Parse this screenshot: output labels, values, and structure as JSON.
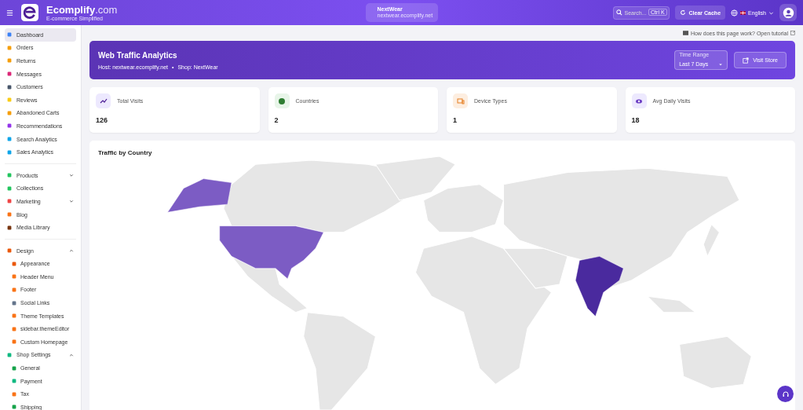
{
  "header": {
    "brand": "Ecomplify",
    "brand_suffix": ".com",
    "tagline": "E-commerce Simplified",
    "store": {
      "name": "NextWear",
      "host": "nextwear.ecomplify.net"
    },
    "search": {
      "placeholder": "Search...",
      "shortcut": "Ctrl K"
    },
    "clear_cache": "Clear Cache",
    "language": "English"
  },
  "sidebar": {
    "sections": [
      {
        "items": [
          {
            "label": "Dashboard",
            "selected": true
          },
          {
            "label": "Orders",
            "selected": false
          },
          {
            "label": "Returns",
            "selected": false
          },
          {
            "label": "Messages",
            "selected": false
          },
          {
            "label": "Customers",
            "selected": false
          },
          {
            "label": "Reviews",
            "selected": false
          },
          {
            "label": "Abandoned Carts",
            "selected": false
          },
          {
            "label": "Recommendations",
            "selected": false
          },
          {
            "label": "Search Analytics",
            "selected": false
          },
          {
            "label": "Sales Analytics",
            "selected": false
          }
        ]
      },
      {
        "items": [
          {
            "label": "Products",
            "selected": false,
            "expanded": false
          },
          {
            "label": "Collections",
            "selected": false
          },
          {
            "label": "Marketing",
            "selected": false,
            "expanded": false
          },
          {
            "label": "Blog",
            "selected": false
          },
          {
            "label": "Media Library",
            "selected": false
          }
        ]
      },
      {
        "items": [
          {
            "label": "Design",
            "selected": false,
            "expanded": true,
            "children": [
              {
                "label": "Appearance",
                "selected": false
              },
              {
                "label": "Header Menu",
                "selected": false
              },
              {
                "label": "Footer",
                "selected": false
              },
              {
                "label": "Social Links",
                "selected": false
              },
              {
                "label": "Theme Templates",
                "selected": false
              },
              {
                "label": "sidebar.themeEditor",
                "selected": false
              },
              {
                "label": "Custom Homepage",
                "selected": false
              }
            ]
          },
          {
            "label": "Shop Settings",
            "selected": false,
            "expanded": true,
            "children": [
              {
                "label": "General",
                "selected": false
              },
              {
                "label": "Payment",
                "selected": false
              },
              {
                "label": "Tax",
                "selected": false
              },
              {
                "label": "Shipping",
                "selected": false
              }
            ]
          }
        ]
      }
    ]
  },
  "tutorial_link": "How does this page work? Open tutorial",
  "banner": {
    "title": "Web Traffic Analytics",
    "host": "Host: nextwear.ecomplify.net",
    "separator": "•",
    "shop": "Shop: NextWear",
    "range_label": "Time Range",
    "range_value": "Last 7 Days",
    "visit_button": "Visit Store"
  },
  "stats": [
    {
      "label": "Total Visits",
      "value": "126",
      "color": "#ede9fe"
    },
    {
      "label": "Countries",
      "value": "2",
      "color": "#e8f5e9"
    },
    {
      "label": "Device Types",
      "value": "1",
      "color": "#fdeee0"
    },
    {
      "label": "Avg Daily Visits",
      "value": "18",
      "color": "#ede9fe"
    }
  ],
  "map": {
    "title": "Traffic by Country",
    "highlights": [
      {
        "kind": "usa",
        "color": "#7c5cc4"
      },
      {
        "kind": "india",
        "color": "#4a2a9e"
      }
    ]
  }
}
